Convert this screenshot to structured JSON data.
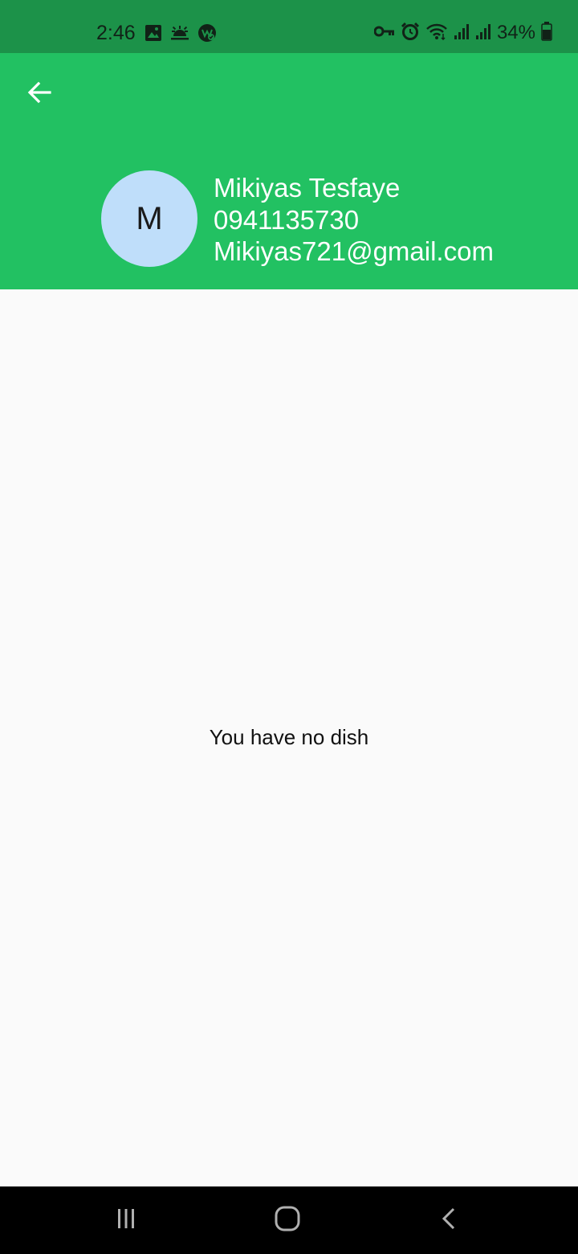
{
  "status_bar": {
    "time": "2:46",
    "left_icons": [
      "image-icon",
      "weather-icon",
      "app-notification-icon"
    ],
    "right_icons": [
      "vpn-key-icon",
      "alarm-icon",
      "wifi-icon",
      "signal-icon",
      "signal-icon",
      "battery-icon"
    ],
    "battery_percent": "34%"
  },
  "header": {
    "color": "#22c162",
    "back_icon": "arrow-left-icon",
    "avatar_initial": "M",
    "name": "Mikiyas Tesfaye",
    "phone": "0941135730",
    "email": "Mikiyas721@gmail.com"
  },
  "main": {
    "empty_message": "You have no dish"
  },
  "nav_bar": {
    "icons": [
      "recent-apps-icon",
      "home-icon",
      "back-icon"
    ]
  }
}
